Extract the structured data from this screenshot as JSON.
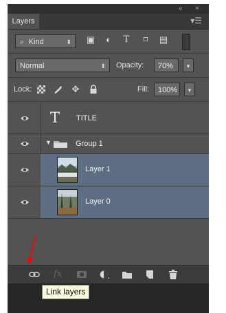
{
  "window": {
    "collapse_icon": "double-chevron-icon",
    "close_icon": "close-icon",
    "collapse_glyph": "«",
    "close_glyph": "×"
  },
  "panel": {
    "tab_label": "Layers",
    "menu_icon": "panel-menu-icon"
  },
  "filter": {
    "kind_label": "Kind",
    "icons": [
      "image-filter-icon",
      "adjustment-filter-icon",
      "type-filter-icon",
      "shape-filter-icon",
      "smart-object-filter-icon"
    ]
  },
  "blend": {
    "mode": "Normal",
    "opacity_label": "Opacity:",
    "opacity_value": "70%"
  },
  "lock": {
    "label": "Lock:",
    "icons": [
      "lock-transparent-pixels-icon",
      "lock-image-pixels-icon",
      "lock-position-icon",
      "lock-all-icon"
    ],
    "fill_label": "Fill:",
    "fill_value": "100%"
  },
  "layers": [
    {
      "name": "TITLE",
      "kind": "type",
      "visible": true,
      "selected": false
    },
    {
      "name": "Group 1",
      "kind": "group",
      "visible": true,
      "selected": false,
      "expanded": true
    },
    {
      "name": "Layer 1",
      "kind": "image",
      "visible": true,
      "selected": true
    },
    {
      "name": "Layer 0",
      "kind": "image",
      "visible": true,
      "selected": true
    }
  ],
  "footer": {
    "buttons": [
      "link-layers-icon",
      "fx-icon",
      "layer-mask-icon",
      "adjustment-layer-icon",
      "new-group-icon",
      "new-layer-icon",
      "trash-icon"
    ],
    "fx_label": "fx"
  },
  "tooltip": {
    "text": "Link layers"
  },
  "colors": {
    "panel_bg": "#535353",
    "selected_row": "#5d6e82",
    "annotation_arrow": "#e01010",
    "tooltip_bg": "#ffffe1"
  }
}
